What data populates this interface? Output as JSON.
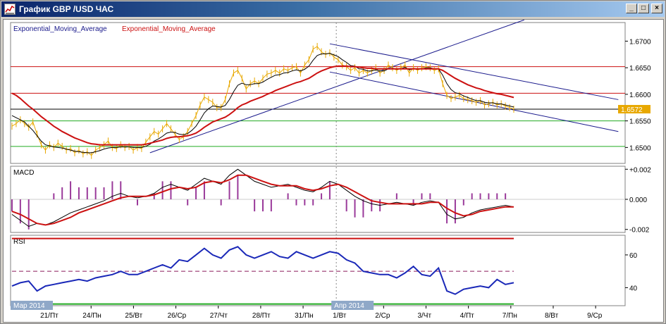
{
  "window": {
    "title": "График GBP /USD  ЧАС",
    "icon": "chart-icon",
    "buttons": {
      "minimize": "_",
      "maximize": "□",
      "close": "×"
    }
  },
  "indicators_label": {
    "ema1": "Exponential_Moving_Average",
    "ema2": "Exponential_Moving_Average"
  },
  "colors": {
    "price": "#e8a800",
    "ema_fast": "#000000",
    "ema_slow": "#cc1111",
    "trend": "#1a1a8c",
    "level_red": "#cc1111",
    "level_green": "#22aa22",
    "rsi": "#1a28b8",
    "macd_hist": "#9a3a9a",
    "current_price_bg": "#e8a800"
  },
  "chart_data": [
    {
      "type": "line",
      "panel": "price",
      "title": "",
      "y_ticks": [
        "1.6700",
        "1.6650",
        "1.6600",
        "1.6550",
        "1.6500"
      ],
      "ylim": [
        1.647,
        1.6735
      ],
      "current_price": "1.6572",
      "horizontal_levels": [
        {
          "value": 1.6652,
          "color": "red"
        },
        {
          "value": 1.6602,
          "color": "red"
        },
        {
          "value": 1.6572,
          "color": "black"
        },
        {
          "value": 1.655,
          "color": "green"
        },
        {
          "value": 1.6502,
          "color": "green"
        }
      ],
      "x": [
        0,
        2,
        4,
        6,
        8,
        10,
        12,
        14,
        16,
        18,
        20,
        22,
        24,
        26,
        28,
        30,
        32,
        34,
        36,
        38,
        40,
        42,
        44,
        46,
        48,
        50,
        52,
        54,
        56,
        58,
        60,
        62,
        64,
        66,
        68,
        70,
        72,
        74,
        76,
        78,
        80,
        82,
        84,
        86,
        88,
        90,
        92,
        94,
        96,
        98,
        100,
        102,
        104,
        106,
        108,
        110,
        112,
        114,
        116,
        118,
        120,
        122,
        124,
        126,
        128,
        130,
        132,
        134,
        136,
        138,
        140,
        142,
        144,
        146,
        148,
        150,
        152,
        154,
        156,
        158,
        160,
        162,
        164,
        166,
        168,
        170,
        172,
        174,
        176,
        178,
        180,
        182,
        184,
        186,
        188,
        190,
        192,
        194,
        196,
        198,
        200,
        202,
        204,
        206,
        208,
        210,
        212,
        214,
        216,
        218,
        220,
        222,
        224,
        226,
        228,
        230,
        232,
        234,
        236,
        238,
        240
      ],
      "series": [
        {
          "name": "",
          "role": "price",
          "values": [
            1.654,
            1.6545,
            1.6552,
            1.6545,
            1.6538,
            1.6548,
            1.6525,
            1.6505,
            1.6495,
            1.6505,
            1.65,
            1.6508,
            1.6502,
            1.6495,
            1.6498,
            1.649,
            1.6495,
            1.6488,
            1.6492,
            1.6485,
            1.6495,
            1.65,
            1.6505,
            1.6512,
            1.65,
            1.6498,
            1.6505,
            1.65,
            1.6502,
            1.6495,
            1.65,
            1.6498,
            1.651,
            1.652,
            1.653,
            1.6525,
            1.6535,
            1.6545,
            1.6535,
            1.6525,
            1.6515,
            1.652,
            1.653,
            1.6545,
            1.656,
            1.658,
            1.6595,
            1.659,
            1.6585,
            1.6575,
            1.6575,
            1.659,
            1.662,
            1.664,
            1.6645,
            1.663,
            1.661,
            1.662,
            1.6625,
            1.662,
            1.663,
            1.6638,
            1.664,
            1.6645,
            1.664,
            1.6648,
            1.6645,
            1.665,
            1.6652,
            1.664,
            1.6655,
            1.6665,
            1.6685,
            1.669,
            1.668,
            1.6675,
            1.6678,
            1.667,
            1.6665,
            1.6655,
            1.6652,
            1.6645,
            1.665,
            1.664,
            1.6645,
            1.664,
            1.6645,
            1.665,
            1.664,
            1.6645,
            1.6655,
            1.665,
            1.6645,
            1.665,
            1.6655,
            1.664,
            1.665,
            1.6645,
            1.665,
            1.6652,
            1.665,
            1.6645,
            1.6648,
            1.662,
            1.6598,
            1.6592,
            1.6595,
            1.6598,
            1.6592,
            1.659,
            1.6588,
            1.6585,
            1.6588,
            1.658,
            1.6582,
            1.6585,
            1.658,
            1.6582,
            1.6578,
            1.6575,
            1.6572
          ]
        },
        {
          "name": "Exponential_Moving_Average",
          "role": "ema_fast",
          "values": [
            1.656,
            1.6556,
            1.6552,
            1.6548,
            1.654,
            1.6532,
            1.6522,
            1.6512,
            1.6505,
            1.6503,
            1.6501,
            1.65,
            1.6499,
            1.6497,
            1.6495,
            1.6493,
            1.6492,
            1.6491,
            1.649,
            1.649,
            1.6492,
            1.6494,
            1.6497,
            1.6499,
            1.65,
            1.65,
            1.6501,
            1.6501,
            1.6501,
            1.65,
            1.65,
            1.65,
            1.6502,
            1.6506,
            1.6512,
            1.6516,
            1.6521,
            1.6527,
            1.6529,
            1.6528,
            1.6525,
            1.6524,
            1.6526,
            1.6532,
            1.654,
            1.6552,
            1.6565,
            1.6573,
            1.6578,
            1.6577,
            1.6576,
            1.6579,
            1.659,
            1.6605,
            1.6617,
            1.6621,
            1.6618,
            1.6618,
            1.662,
            1.662,
            1.6623,
            1.6628,
            1.6632,
            1.6636,
            1.6637,
            1.664,
            1.6641,
            1.6644,
            1.6646,
            1.6644,
            1.6647,
            1.6653,
            1.6664,
            1.6673,
            1.6676,
            1.6676,
            1.6677,
            1.6674,
            1.6671,
            1.6665,
            1.666,
            1.6654,
            1.6653,
            1.6648,
            1.6647,
            1.6644,
            1.6644,
            1.6646,
            1.6644,
            1.6644,
            1.6648,
            1.6649,
            1.6647,
            1.6648,
            1.6651,
            1.6646,
            1.6648,
            1.6647,
            1.6648,
            1.665,
            1.665,
            1.6648,
            1.6648,
            1.6636,
            1.662,
            1.6609,
            1.6603,
            1.6601,
            1.6597,
            1.6594,
            1.6591,
            1.6588,
            1.6588,
            1.6585,
            1.6584,
            1.6584,
            1.6582,
            1.6582,
            1.658,
            1.6578,
            1.6576
          ]
        },
        {
          "name": "Exponential_Moving_Average",
          "role": "ema_slow",
          "values": [
            1.6602,
            1.6598,
            1.6592,
            1.6585,
            1.6578,
            1.6572,
            1.6565,
            1.6558,
            1.6552,
            1.6546,
            1.654,
            1.6535,
            1.653,
            1.6526,
            1.6522,
            1.6518,
            1.6515,
            1.6512,
            1.6509,
            1.6507,
            1.6506,
            1.6505,
            1.6505,
            1.6505,
            1.6505,
            1.6505,
            1.6505,
            1.6505,
            1.6505,
            1.6505,
            1.6505,
            1.6505,
            1.6506,
            1.6508,
            1.651,
            1.6512,
            1.6514,
            1.6517,
            1.6519,
            1.652,
            1.652,
            1.6521,
            1.6522,
            1.6524,
            1.6527,
            1.6532,
            1.6538,
            1.6543,
            1.6548,
            1.6551,
            1.6554,
            1.6557,
            1.6562,
            1.6568,
            1.6575,
            1.658,
            1.6583,
            1.6587,
            1.659,
            1.6593,
            1.6596,
            1.66,
            1.6603,
            1.6607,
            1.661,
            1.6613,
            1.6616,
            1.6619,
            1.6622,
            1.6624,
            1.6627,
            1.663,
            1.6635,
            1.664,
            1.6644,
            1.6647,
            1.665,
            1.6652,
            1.6653,
            1.6653,
            1.6653,
            1.6652,
            1.6652,
            1.6651,
            1.665,
            1.6649,
            1.6649,
            1.6648,
            1.6648,
            1.6648,
            1.6648,
            1.6648,
            1.6648,
            1.6648,
            1.6648,
            1.6648,
            1.6648,
            1.6648,
            1.6648,
            1.6648,
            1.6648,
            1.6648,
            1.6648,
            1.6645,
            1.664,
            1.6635,
            1.663,
            1.6626,
            1.6622,
            1.6618,
            1.6615,
            1.6612,
            1.661,
            1.6607,
            1.6605,
            1.6603,
            1.6601,
            1.66,
            1.6598,
            1.6596,
            1.6594
          ]
        }
      ],
      "trend_lines": [
        {
          "x0": 66,
          "y0": 1.649,
          "x1": 245,
          "y1": 1.674
        },
        {
          "x0": 152,
          "y0": 1.6695,
          "x1": 290,
          "y1": 1.659
        },
        {
          "x0": 152,
          "y0": 1.6642,
          "x1": 290,
          "y1": 1.653
        }
      ]
    },
    {
      "type": "line",
      "panel": "macd",
      "title": "MACD",
      "y_ticks": [
        "+0.002",
        "0.000",
        "-0.002"
      ],
      "ylim": [
        -0.0022,
        0.0022
      ],
      "x": [
        0,
        4,
        8,
        12,
        16,
        20,
        24,
        28,
        32,
        36,
        40,
        44,
        48,
        52,
        56,
        60,
        64,
        68,
        72,
        76,
        80,
        84,
        88,
        92,
        96,
        100,
        104,
        108,
        112,
        116,
        120,
        124,
        128,
        132,
        136,
        140,
        144,
        148,
        152,
        156,
        160,
        164,
        168,
        172,
        176,
        180,
        184,
        188,
        192,
        196,
        200,
        204,
        208,
        212,
        216,
        220,
        224,
        228,
        232,
        236,
        240
      ],
      "series": [
        {
          "name": "",
          "role": "macd_main",
          "values": [
            -0.001,
            -0.0014,
            -0.0018,
            -0.0016,
            -0.0017,
            -0.0015,
            -0.0012,
            -0.0009,
            -0.0007,
            -0.0005,
            -0.0003,
            -0.0001,
            0.0002,
            0.0004,
            0.0002,
            0.0001,
            0.0002,
            0.0004,
            0.0008,
            0.001,
            0.0008,
            0.0006,
            0.001,
            0.0014,
            0.0012,
            0.001,
            0.0016,
            0.002,
            0.0016,
            0.0012,
            0.001,
            0.0008,
            0.0009,
            0.001,
            0.0008,
            0.0006,
            0.0005,
            0.0008,
            0.0012,
            0.001,
            0.0006,
            0.0002,
            -0.0001,
            -0.0003,
            -0.0004,
            -0.0003,
            -0.0002,
            -0.0003,
            -0.0004,
            -0.0002,
            -0.0001,
            -0.0002,
            -0.001,
            -0.0013,
            -0.0012,
            -0.0009,
            -0.0007,
            -0.0006,
            -0.0005,
            -0.0004,
            -0.0005
          ]
        },
        {
          "name": "",
          "role": "macd_signal",
          "values": [
            -0.0008,
            -0.001,
            -0.0013,
            -0.0016,
            -0.0017,
            -0.0016,
            -0.0014,
            -0.0012,
            -0.0009,
            -0.0007,
            -0.0005,
            -0.0003,
            -0.0001,
            0.0001,
            0.0002,
            0.0002,
            0.0002,
            0.0003,
            0.0005,
            0.0007,
            0.0008,
            0.0007,
            0.0008,
            0.0011,
            0.0012,
            0.0011,
            0.0013,
            0.0016,
            0.0016,
            0.0014,
            0.0012,
            0.001,
            0.0009,
            0.0009,
            0.0009,
            0.0007,
            0.0006,
            0.0007,
            0.0009,
            0.001,
            0.0008,
            0.0005,
            0.0002,
            -0.0001,
            -0.0002,
            -0.0003,
            -0.0003,
            -0.0003,
            -0.0003,
            -0.0003,
            -0.0002,
            -0.0002,
            -0.0006,
            -0.0009,
            -0.0011,
            -0.001,
            -0.0008,
            -0.0007,
            -0.0006,
            -0.0005,
            -0.0005
          ]
        }
      ]
    },
    {
      "type": "line",
      "panel": "rsi",
      "title": "RSI",
      "y_ticks": [
        "60",
        "40"
      ],
      "ylim": [
        29,
        72
      ],
      "levels": [
        70,
        50,
        30
      ],
      "x": [
        0,
        4,
        8,
        12,
        16,
        20,
        24,
        28,
        32,
        36,
        40,
        44,
        48,
        52,
        56,
        60,
        64,
        68,
        72,
        76,
        80,
        84,
        88,
        92,
        96,
        100,
        104,
        108,
        112,
        116,
        120,
        124,
        128,
        132,
        136,
        140,
        144,
        148,
        152,
        156,
        160,
        164,
        168,
        172,
        176,
        180,
        184,
        188,
        192,
        196,
        200,
        204,
        208,
        212,
        216,
        220,
        224,
        228,
        232,
        236,
        240
      ],
      "series": [
        {
          "name": "",
          "role": "rsi",
          "values": [
            41,
            43,
            44,
            38,
            41,
            42,
            43,
            44,
            45,
            44,
            46,
            47,
            48,
            50,
            48,
            48,
            50,
            52,
            54,
            52,
            57,
            56,
            60,
            64,
            60,
            58,
            63,
            65,
            60,
            58,
            60,
            62,
            59,
            58,
            62,
            60,
            58,
            60,
            62,
            61,
            57,
            55,
            50,
            49,
            48,
            48,
            46,
            49,
            53,
            48,
            47,
            52,
            38,
            36,
            39,
            40,
            41,
            40,
            45,
            42,
            43
          ]
        }
      ]
    }
  ],
  "panels": {
    "price": {
      "label_ema1": "Exponential_Moving_Average",
      "label_ema2": "Exponential_Moving_Average"
    },
    "macd": {
      "label": "MACD"
    },
    "rsi": {
      "label": "RSI"
    }
  },
  "x_axis": {
    "labels": [
      {
        "text": "21/Пт",
        "pos": 0.062
      },
      {
        "text": "24/Пн",
        "pos": 0.131
      },
      {
        "text": "25/Вт",
        "pos": 0.2
      },
      {
        "text": "26/Ср",
        "pos": 0.269
      },
      {
        "text": "27/Чт",
        "pos": 0.338
      },
      {
        "text": "28/Пт",
        "pos": 0.407
      },
      {
        "text": "31/Пн",
        "pos": 0.476
      },
      {
        "text": "1/Вт",
        "pos": 0.538
      },
      {
        "text": "2/Ср",
        "pos": 0.607
      },
      {
        "text": "3/Чт",
        "pos": 0.676
      },
      {
        "text": "4/Пт",
        "pos": 0.745
      },
      {
        "text": "7/Пн",
        "pos": 0.814
      },
      {
        "text": "8/Вт",
        "pos": 0.883
      },
      {
        "text": "9/Ср",
        "pos": 0.952
      }
    ],
    "month_markers": [
      {
        "text": "Мар 2014",
        "pos": 0.0
      },
      {
        "text": "Апр 2014",
        "pos": 0.522
      }
    ]
  }
}
